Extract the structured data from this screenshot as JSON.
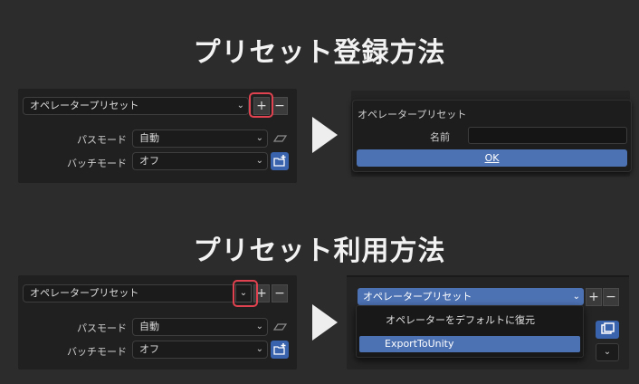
{
  "section1": {
    "title": "プリセット登録方法",
    "preset_dropdown": "オペレータープリセット",
    "chevron": "⌄",
    "add": "+",
    "remove": "−",
    "path_mode_label": "パスモード",
    "path_mode_value": "自動",
    "batch_mode_label": "バッチモード",
    "batch_mode_value": "オフ",
    "dialog": {
      "title": "オペレータープリセット",
      "name_label": "名前",
      "name_value": "",
      "ok": "OK"
    }
  },
  "section2": {
    "title": "プリセット利用方法",
    "preset_dropdown": "オペレータープリセット",
    "chevron": "⌄",
    "add": "+",
    "remove": "−",
    "path_mode_label": "パスモード",
    "path_mode_value": "自動",
    "batch_mode_label": "バッチモード",
    "batch_mode_value": "オフ",
    "menu": {
      "header": "オペレータープリセット",
      "items": [
        "オペレーターをデフォルトに復元",
        "ExportToUnity"
      ]
    }
  },
  "colors": {
    "highlight": "#e0434f",
    "accent": "#4d72b3"
  }
}
